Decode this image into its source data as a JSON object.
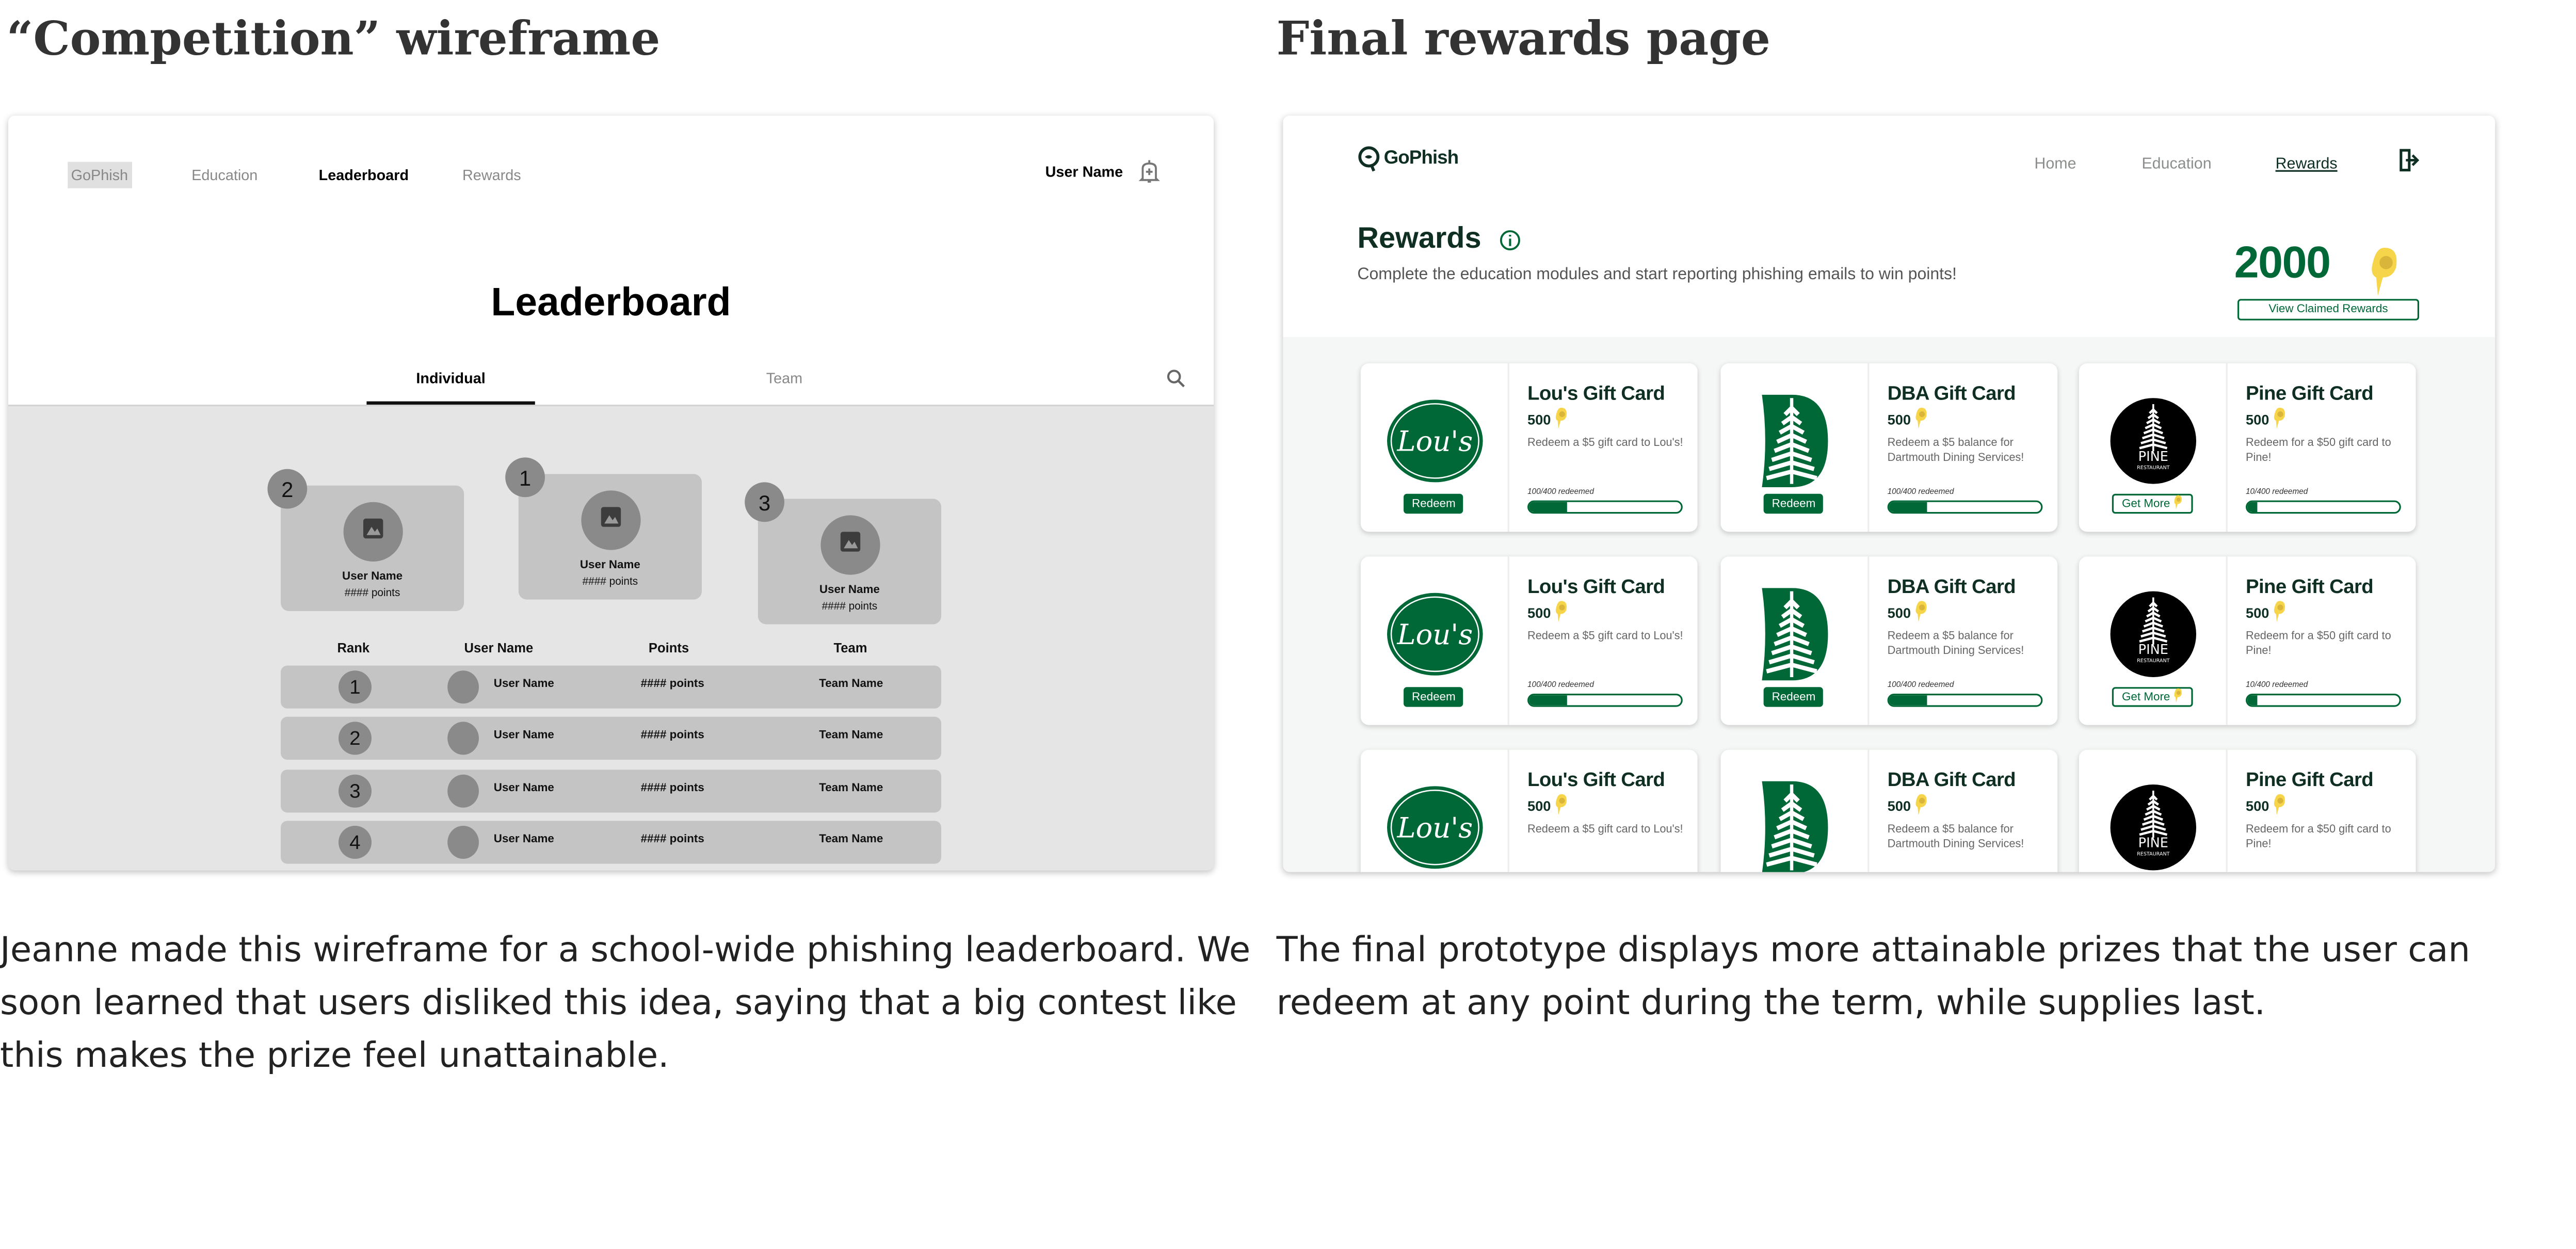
{
  "left": {
    "heading": "“Competition” wireframe",
    "caption": "Jeanne made this wireframe for a school-wide phishing leaderboard. We soon learned that users disliked this idea, saying that a big contest like this makes the prize feel unattainable.",
    "nav": {
      "brand": "GoPhish",
      "items": [
        "Education",
        "Leaderboard",
        "Rewards"
      ],
      "active": "Leaderboard",
      "user": "User Name",
      "bell_icon": "bell-icon"
    },
    "page_title": "Leaderboard",
    "tabs": [
      "Individual",
      "Team"
    ],
    "active_tab": "Individual",
    "podium": [
      {
        "rank": "2",
        "name": "User Name",
        "points": "#### points"
      },
      {
        "rank": "1",
        "name": "User Name",
        "points": "#### points"
      },
      {
        "rank": "3",
        "name": "User Name",
        "points": "#### points"
      }
    ],
    "table": {
      "headers": [
        "Rank",
        "User Name",
        "Points",
        "Team"
      ],
      "rows": [
        {
          "rank": "1",
          "name": "User Name",
          "points": "#### points",
          "team": "Team Name"
        },
        {
          "rank": "2",
          "name": "User Name",
          "points": "#### points",
          "team": "Team Name"
        },
        {
          "rank": "3",
          "name": "User Name",
          "points": "#### points",
          "team": "Team Name"
        },
        {
          "rank": "4",
          "name": "User Name",
          "points": "#### points",
          "team": "Team Name"
        }
      ]
    }
  },
  "right": {
    "heading": "Final rewards page",
    "caption": "The final prototype displays more attainable prizes that the user can redeem at any point during the term, while supplies last.",
    "nav": {
      "brand": "GoPhish",
      "items": [
        "Home",
        "Education",
        "Rewards"
      ],
      "active": "Rewards",
      "logout_icon": "logout-icon"
    },
    "title": "Rewards",
    "subtitle": "Complete the education modules and start reporting phishing emails to win points!",
    "balance": "2000",
    "view_claimed": "View Claimed Rewards",
    "colors": {
      "primary": "#006837",
      "dark": "#0f2f23",
      "coin": "#f7d54a",
      "background": "#f5f7f6"
    },
    "logos": {
      "lous": "Lou's",
      "pine": "PINE",
      "pine_sub": "RESTAURANT"
    },
    "rewards": [
      {
        "logo": "lous",
        "title": "Lou's Gift Card",
        "cost": "500",
        "desc": "Redeem a $5 gift card to Lou's!",
        "redeemed": "100/400 redeemed",
        "progress": 0.25,
        "button": "Redeem",
        "button_style": "filled"
      },
      {
        "logo": "dba",
        "title": "DBA Gift Card",
        "cost": "500",
        "desc": "Redeem a $5 balance for Dartmouth Dining Services!",
        "redeemed": "100/400 redeemed",
        "progress": 0.25,
        "button": "Redeem",
        "button_style": "filled"
      },
      {
        "logo": "pine",
        "title": "Pine Gift Card",
        "cost": "500",
        "desc": "Redeem for a $50 gift card to Pine!",
        "redeemed": "10/400 redeemed",
        "progress": 0.025,
        "button": "Get More",
        "button_style": "outline"
      },
      {
        "logo": "lous",
        "title": "Lou's Gift Card",
        "cost": "500",
        "desc": "Redeem a $5 gift card to Lou's!",
        "redeemed": "100/400 redeemed",
        "progress": 0.25,
        "button": "Redeem",
        "button_style": "filled"
      },
      {
        "logo": "dba",
        "title": "DBA Gift Card",
        "cost": "500",
        "desc": "Redeem a $5 balance for Dartmouth Dining Services!",
        "redeemed": "100/400 redeemed",
        "progress": 0.25,
        "button": "Redeem",
        "button_style": "filled"
      },
      {
        "logo": "pine",
        "title": "Pine Gift Card",
        "cost": "500",
        "desc": "Redeem for a $50 gift card to Pine!",
        "redeemed": "10/400 redeemed",
        "progress": 0.025,
        "button": "Get More",
        "button_style": "outline"
      },
      {
        "logo": "lous",
        "title": "Lou's Gift Card",
        "cost": "500",
        "desc": "Redeem a $5 gift card to Lou's!"
      },
      {
        "logo": "dba",
        "title": "DBA Gift Card",
        "cost": "500",
        "desc": "Redeem a $5 balance for Dartmouth Dining Services!"
      },
      {
        "logo": "pine",
        "title": "Pine Gift Card",
        "cost": "500",
        "desc": "Redeem for a $50 gift card to Pine!"
      }
    ]
  }
}
